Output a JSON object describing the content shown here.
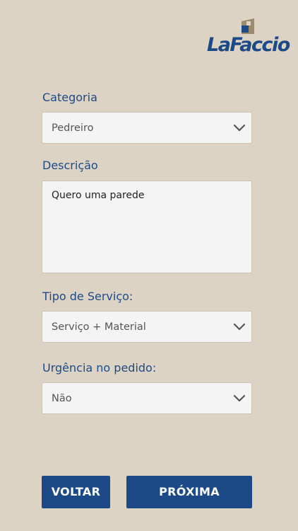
{
  "brand": {
    "logo_text": "LaFaccio",
    "logo_icon": "lafaccio-cube-icon",
    "primary_color": "#1c4a86",
    "accent_color": "#9c8a6c",
    "background_color": "#ddd3c5"
  },
  "form": {
    "categoria": {
      "label": "Categoria",
      "value": "Pedreiro"
    },
    "descricao": {
      "label": "Descrição",
      "value": "Quero uma parede"
    },
    "tipo_servico": {
      "label": "Tipo de Serviço:",
      "value": "Serviço + Material"
    },
    "urgencia": {
      "label": "Urgência no pedido:",
      "value": "Não"
    }
  },
  "actions": {
    "back_label": "VOLTAR",
    "next_label": "PRÓXIMA"
  },
  "icons": {
    "dropdown": "chevron-down-icon"
  }
}
